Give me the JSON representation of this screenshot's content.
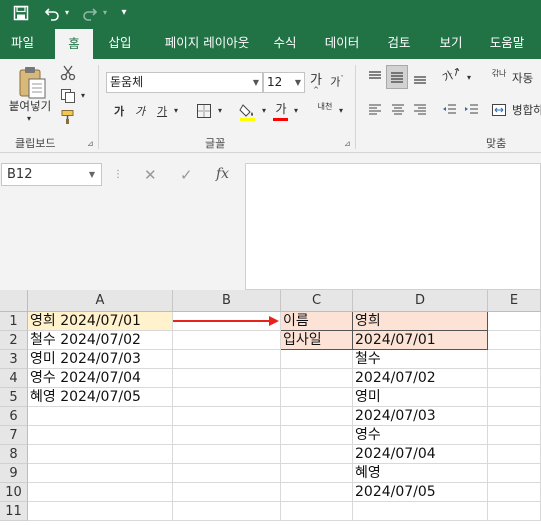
{
  "qat": {
    "save_icon": "save-icon",
    "undo_icon": "undo-icon",
    "redo_icon": "redo-icon",
    "customize_icon": "customize-qat-icon"
  },
  "tabs": [
    {
      "label": "파일"
    },
    {
      "label": "홈"
    },
    {
      "label": "삽입"
    },
    {
      "label": "페이지 레이아웃"
    },
    {
      "label": "수식"
    },
    {
      "label": "데이터"
    },
    {
      "label": "검토"
    },
    {
      "label": "보기"
    },
    {
      "label": "도움말"
    }
  ],
  "ribbon": {
    "clipboard": {
      "paste_label": "붙여넣기",
      "group_label": "클립보드"
    },
    "font": {
      "font_name": "돋움체",
      "font_size": "12",
      "grow_glyph": "가",
      "shrink_glyph": "가",
      "bold_glyph": "가",
      "italic_glyph": "가",
      "underline_glyph": "가",
      "font_color_glyph": "가",
      "phonetic_glyph": "내천",
      "group_label": "글꼴"
    },
    "alignment": {
      "wrap_label": "자동",
      "merge_label": "병합하",
      "orient_glyph": "가",
      "wrap_glyph": "갂나",
      "group_label": "맞춤"
    }
  },
  "formula_bar": {
    "name_box": "B12",
    "cancel_glyph": "✕",
    "enter_glyph": "✓",
    "fx_glyph": "fx",
    "content": ""
  },
  "sheet": {
    "columns": [
      "A",
      "B",
      "C",
      "D",
      "E"
    ],
    "rows": [
      "1",
      "2",
      "3",
      "4",
      "5",
      "6",
      "7",
      "8",
      "9",
      "10",
      "11"
    ],
    "cells": {
      "A": [
        "영희  2024/07/01",
        "철수  2024/07/02",
        "영미  2024/07/03",
        "영수  2024/07/04",
        "혜영  2024/07/05",
        "",
        "",
        "",
        "",
        "",
        ""
      ],
      "C": [
        "이름",
        "입사일",
        "",
        "",
        "",
        "",
        "",
        "",
        "",
        "",
        ""
      ],
      "D": [
        "영희",
        "2024/07/01",
        "철수",
        "2024/07/02",
        "영미",
        "2024/07/03",
        "영수",
        "2024/07/04",
        "혜영",
        "2024/07/05",
        ""
      ]
    },
    "highlight_color": "#fde3d6",
    "source_highlight_color": "#fff2cc",
    "arrow_color": "#e8231b"
  },
  "colors": {
    "accent": "#217346",
    "ribbon_bg": "#f3f3f3"
  }
}
